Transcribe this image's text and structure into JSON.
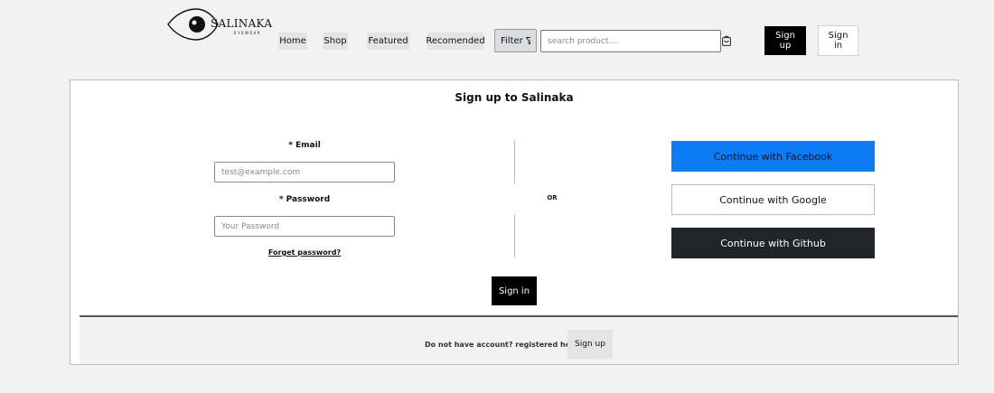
{
  "header": {
    "logo": {
      "brand": "SALINAKA",
      "sub": "EYEWEAR"
    },
    "nav": [
      "Home",
      "Shop",
      "Featured",
      "Recomended"
    ],
    "filter_label": "Filter",
    "search_placeholder": "search product....",
    "signup_label": "Sign up",
    "signin_label": "Sign in"
  },
  "form": {
    "title": "Sign up to Salinaka",
    "email_label": "* Email",
    "email_placeholder": "test@example.com",
    "password_label": "* Password",
    "password_placeholder": "Your Password",
    "forget_label": "Forget password?",
    "or_label": "OR",
    "social": {
      "facebook": "Continue with Facebook",
      "google": "Continue with Google",
      "github": "Continue with Github"
    },
    "signin_label": "Sign in"
  },
  "footer": {
    "text": "Do not have account? registered here",
    "signup_label": "Sign up"
  },
  "colors": {
    "facebook": "#0d7bf3",
    "github": "#212529",
    "primary": "#000000"
  }
}
